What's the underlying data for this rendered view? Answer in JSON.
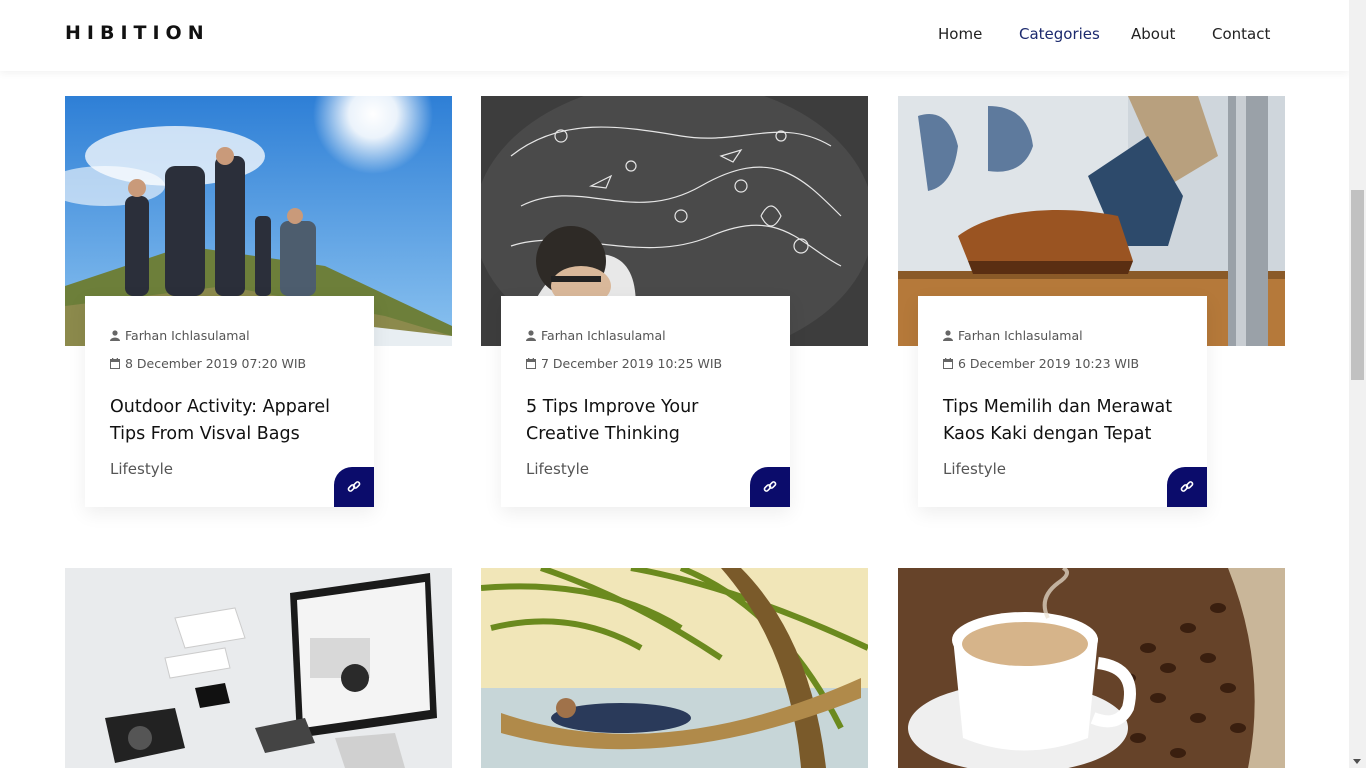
{
  "brand": "HIBITION",
  "nav": {
    "home": "Home",
    "categories": "Categories",
    "about": "About",
    "contact": "Contact"
  },
  "posts": [
    {
      "author": "Farhan Ichlasulamal",
      "date": "8 December 2019 07:20 WIB",
      "title": "Outdoor Activity: Apparel Tips From Visval Bags",
      "category": "Lifestyle",
      "image": "hikers-mountain-photo"
    },
    {
      "author": "Farhan Ichlasulamal",
      "date": "7 December 2019 10:25 WIB",
      "title": "5 Tips Improve Your Creative Thinking",
      "category": "Lifestyle",
      "image": "man-doodles-chalkboard-photo"
    },
    {
      "author": "Farhan Ichlasulamal",
      "date": "6 December 2019 10:23 WIB",
      "title": "Tips Memilih dan Merawat Kaos Kaki dengan Tepat",
      "category": "Lifestyle",
      "image": "shoe-socks-photo"
    },
    {
      "image": "devices-mockup-photo"
    },
    {
      "image": "hammock-palm-beach-photo"
    },
    {
      "image": "coffee-cup-beans-photo"
    }
  ],
  "colors": {
    "accent": "#0b0c6b",
    "active_nav": "#1c2a6e"
  },
  "icons": {
    "author": "user-icon",
    "date": "calendar-icon",
    "link": "link-icon"
  }
}
